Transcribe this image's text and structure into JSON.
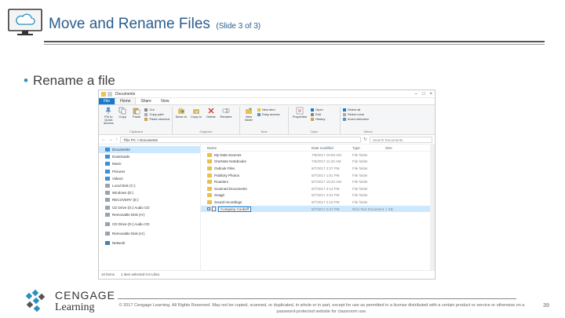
{
  "slide": {
    "title": "Move and Rename Files",
    "title_suffix": "(Slide 3 of 3)",
    "bullet": "Rename a file",
    "page_number": "39",
    "copyright_line1": "© 2017 Cengage Learning. All Rights Reserved. May not be copied, scanned, or duplicated, in whole or in part, except for use as permitted in a license distributed with a certain product or service or otherwise on a",
    "copyright_line2": "password-protected website for classroom use."
  },
  "brand": {
    "line1": "CENGAGE",
    "line2": "Learning",
    "accent": "#2a8fbd"
  },
  "explorer": {
    "window_title": "Documents",
    "tabs": [
      "File",
      "Home",
      "Share",
      "View"
    ],
    "ribbon": {
      "clipboard": {
        "group": "Clipboard",
        "pin": "Pin to Quick access",
        "copy": "Copy",
        "paste": "Paste",
        "cut": "Cut",
        "copy_path": "Copy path",
        "paste_shortcut": "Paste shortcut"
      },
      "organize": {
        "group": "Organize",
        "move_to": "Move to",
        "copy_to": "Copy to",
        "delete": "Delete",
        "rename": "Rename"
      },
      "new": {
        "group": "New",
        "new_folder": "New folder",
        "new_item": "New item",
        "easy_access": "Easy access"
      },
      "open": {
        "group": "Open",
        "properties": "Properties",
        "open": "Open",
        "edit": "Edit",
        "history": "History"
      },
      "select": {
        "group": "Select",
        "select_all": "Select all",
        "select_none": "Select none",
        "invert": "Invert selection"
      }
    },
    "address_path": "This PC > Documents",
    "search_placeholder": "Search Documents",
    "nav_items": [
      "Documents",
      "Downloads",
      "Music",
      "Pictures",
      "Videos",
      "Local Disk (C:)",
      "Windows (D:)",
      "RECOVERY (E:)",
      "CD Drive (G:) Audio CD",
      "Removable Disk (H:)",
      "CD Drive (G:) Audio CD",
      "Removable Disk (H:)",
      "Network"
    ],
    "columns": {
      "name": "Name",
      "date": "Date modified",
      "type": "Type",
      "size": "Size"
    },
    "files": [
      {
        "name": "My Data Sources",
        "date": "7/6/2017 10:55 AM",
        "type": "File folder",
        "size": ""
      },
      {
        "name": "OneNote Notebooks",
        "date": "7/6/2017 11:40 AM",
        "type": "File folder",
        "size": ""
      },
      {
        "name": "Outlook Files",
        "date": "8/7/2017 2:37 PM",
        "type": "File folder",
        "size": ""
      },
      {
        "name": "Publicity Photos",
        "date": "8/7/2017 1:51 PM",
        "type": "File folder",
        "size": ""
      },
      {
        "name": "Roasters",
        "date": "8/7/2017 10:22 AM",
        "type": "File folder",
        "size": ""
      },
      {
        "name": "Scanned Documents",
        "date": "8/7/2017 3:13 PM",
        "type": "File folder",
        "size": ""
      },
      {
        "name": "Snagit",
        "date": "8/7/2017 4:01 PM",
        "type": "File folder",
        "size": ""
      },
      {
        "name": "Sound recordings",
        "date": "8/7/2017 2:15 PM",
        "type": "File folder",
        "size": ""
      },
      {
        "name": "Company Cookoff",
        "date": "8/7/2017 2:27 PM",
        "type": "Rich Text Document",
        "size": "1 KB"
      }
    ],
    "status_count": "10 items",
    "status_selected": "1 item selected  0.5 Libra"
  }
}
